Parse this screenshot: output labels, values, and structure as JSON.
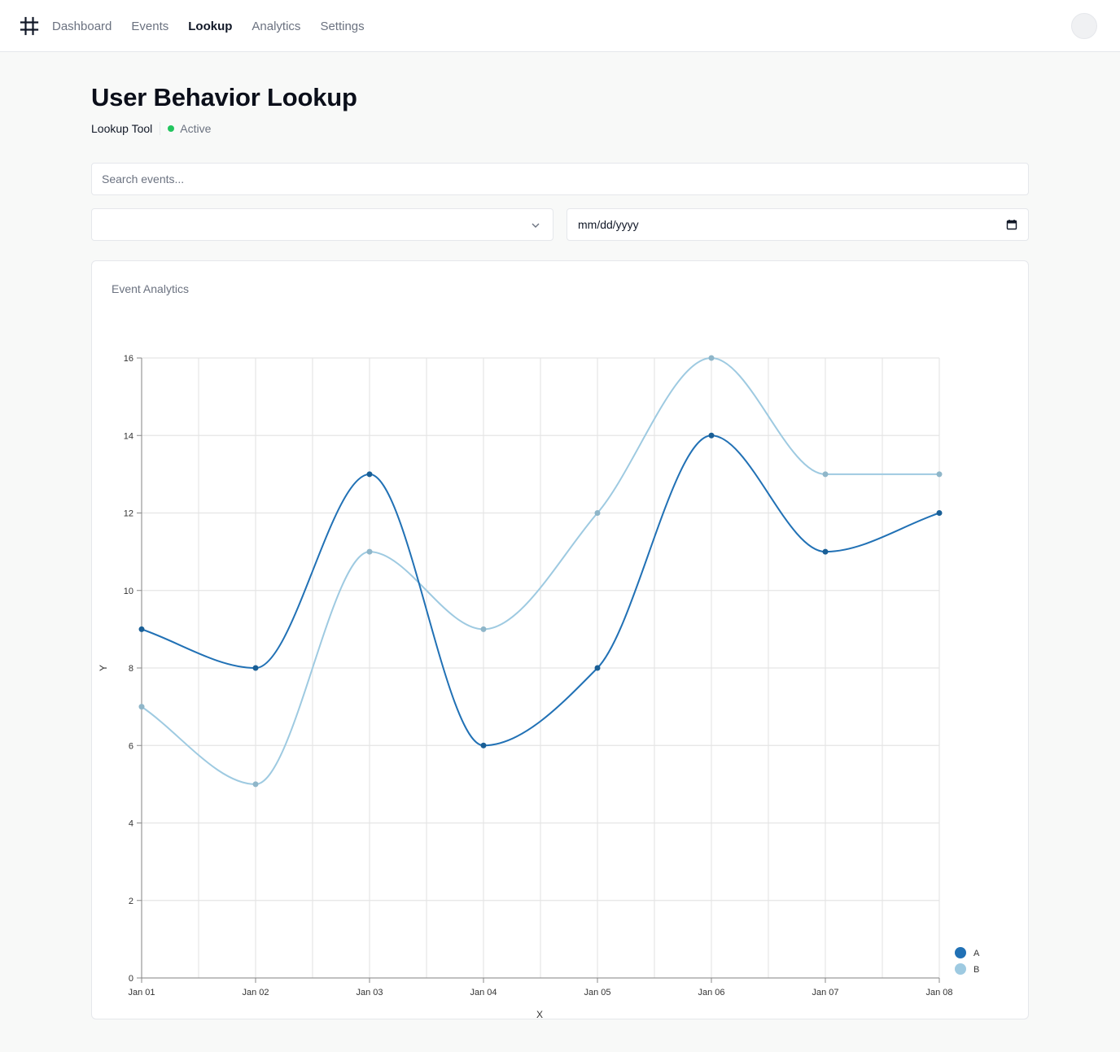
{
  "nav": {
    "logo_icon": "hash-icon",
    "items": [
      {
        "label": "Dashboard",
        "active": false
      },
      {
        "label": "Events",
        "active": false
      },
      {
        "label": "Lookup",
        "active": true
      },
      {
        "label": "Analytics",
        "active": false
      },
      {
        "label": "Settings",
        "active": false
      }
    ],
    "avatar_icon": "avatar-icon"
  },
  "header": {
    "title": "User Behavior Lookup",
    "tool_label": "Lookup Tool",
    "status": "Active",
    "status_color": "#22c55e"
  },
  "filters": {
    "search_placeholder": "Search events...",
    "select_value": "",
    "date_placeholder": "mm/dd/yyyy"
  },
  "card": {
    "title": "Event Analytics"
  },
  "chart_data": {
    "type": "line",
    "title": "",
    "xlabel": "X",
    "ylabel": "Y",
    "categories": [
      "Jan 01",
      "Jan 02",
      "Jan 03",
      "Jan 04",
      "Jan 05",
      "Jan 06",
      "Jan 07",
      "Jan 08"
    ],
    "series": [
      {
        "name": "A",
        "color": "#2171b5",
        "values": [
          9,
          8,
          13,
          6,
          8,
          14,
          11,
          12
        ]
      },
      {
        "name": "B",
        "color": "#9ecae1",
        "values": [
          7,
          5,
          11,
          9,
          12,
          16,
          13,
          13
        ]
      }
    ],
    "ylim": [
      0,
      16
    ],
    "yticks": [
      0,
      2,
      4,
      6,
      8,
      10,
      12,
      14,
      16
    ],
    "grid": true,
    "legend": "bottom-right",
    "curve": "smooth"
  }
}
